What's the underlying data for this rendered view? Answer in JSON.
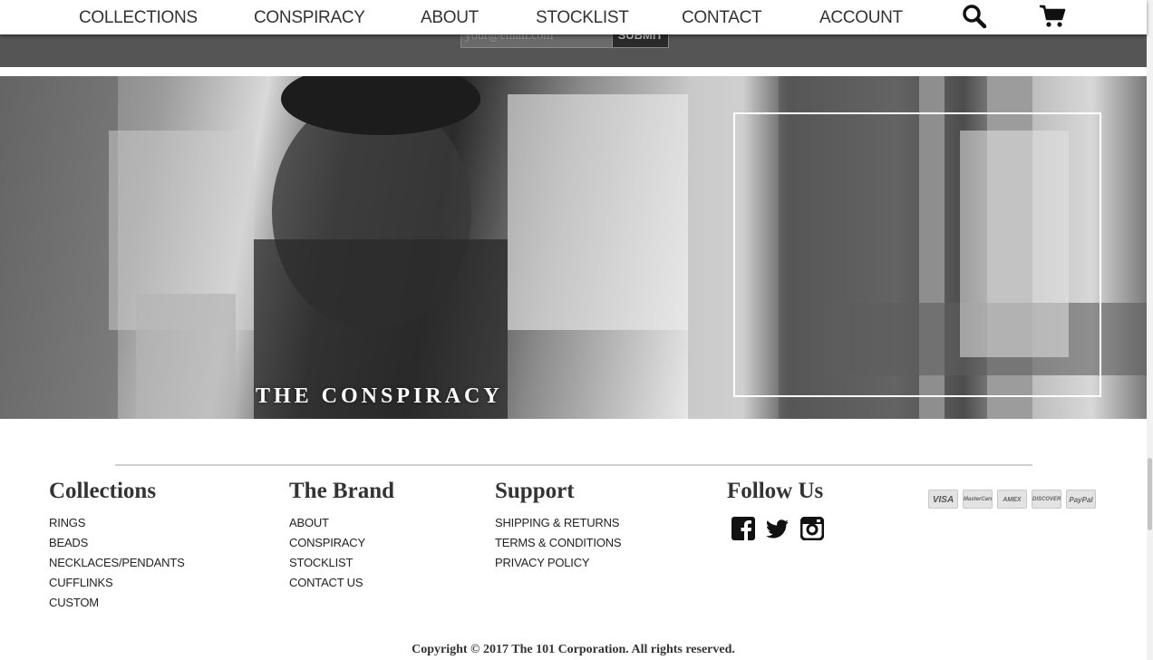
{
  "nav": {
    "items": [
      "COLLECTIONS",
      "CONSPIRACY",
      "ABOUT",
      "STOCKLIST",
      "CONTACT",
      "ACCOUNT"
    ],
    "search_icon": "search-icon",
    "cart_icon": "cart-icon"
  },
  "newsletter": {
    "email_placeholder": "your@email.com",
    "submit_label": "SUBMIT"
  },
  "banner": {
    "left_title": "THE CONSPIRACY"
  },
  "footer": {
    "collections": {
      "heading": "Collections",
      "links": [
        "RINGS",
        "BEADS",
        "NECKLACES/PENDANTS",
        "CUFFLINKS",
        "CUSTOM"
      ]
    },
    "brand": {
      "heading": "The Brand",
      "links": [
        "ABOUT",
        "CONSPIRACY",
        "STOCKLIST",
        "CONTACT US"
      ]
    },
    "support": {
      "heading": "Support",
      "links": [
        "SHIPPING & RETURNS",
        "TERMS & CONDITIONS",
        "PRIVACY POLICY"
      ]
    },
    "follow": {
      "heading": "Follow Us",
      "icons": [
        "facebook-icon",
        "twitter-icon",
        "instagram-icon"
      ]
    },
    "payment_cards": [
      "VISA",
      "MasterCard",
      "AMEX",
      "DISCOVER",
      "PayPal"
    ],
    "copyright": "Copyright © 2017 The 101 Corporation. All rights reserved."
  }
}
